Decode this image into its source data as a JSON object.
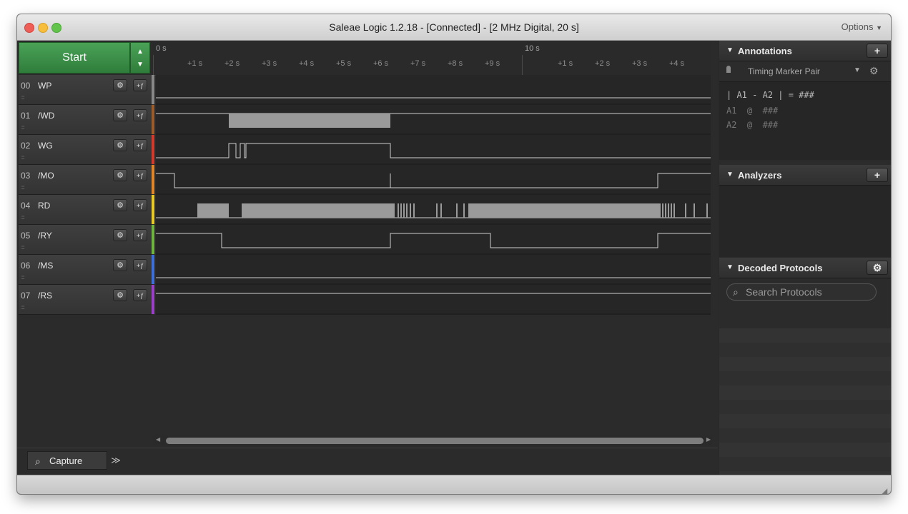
{
  "window": {
    "title": "Saleae Logic 1.2.18 - [Connected] - [2 MHz Digital, 20 s]",
    "options_label": "Options",
    "options_chevron": "▼"
  },
  "toolbar": {
    "start_label": "Start",
    "up_arrow": "▲",
    "down_arrow": "▼"
  },
  "ruler": {
    "major": [
      {
        "label": "0 s"
      },
      {
        "label": "10 s"
      }
    ],
    "ticks": [
      "+1 s",
      "+2 s",
      "+3 s",
      "+4 s",
      "+5 s",
      "+6 s",
      "+7 s",
      "+8 s",
      "+9 s",
      "+1 s",
      "+2 s",
      "+3 s",
      "+4 s"
    ]
  },
  "channels": [
    {
      "num": "00",
      "name": "WP",
      "color": "#888888"
    },
    {
      "num": "01",
      "name": "/WD",
      "color": "#9b5b2b"
    },
    {
      "num": "02",
      "name": "WG",
      "color": "#d33a2c"
    },
    {
      "num": "03",
      "name": "/MO",
      "color": "#e0852a"
    },
    {
      "num": "04",
      "name": "RD",
      "color": "#e6c927"
    },
    {
      "num": "05",
      "name": "/RY",
      "color": "#6fb43f"
    },
    {
      "num": "06",
      "name": "/MS",
      "color": "#3e6fd8"
    },
    {
      "num": "07",
      "name": "/RS",
      "color": "#9a3fc6"
    }
  ],
  "channel_buttons": {
    "gear": "⚙",
    "trigger": "+ƒ"
  },
  "scrollbar": {
    "left_arrow": "◀",
    "right_arrow": "▶"
  },
  "tabs": {
    "capture_label": "Capture",
    "more_label": "≫"
  },
  "annotations": {
    "title": "Annotations",
    "add": "+",
    "timing_marker": "Timing Marker Pair",
    "formula_line": "| A1 - A2 | = ###",
    "a1_line": "A1  @  ###",
    "a2_line": "A2  @  ###"
  },
  "analyzers": {
    "title": "Analyzers",
    "add": "+"
  },
  "decoded": {
    "title": "Decoded Protocols",
    "gear": "⚙",
    "search_placeholder": "Search Protocols"
  },
  "icons": {
    "collapse": "▼",
    "pin": "📍",
    "search": "⌕"
  }
}
